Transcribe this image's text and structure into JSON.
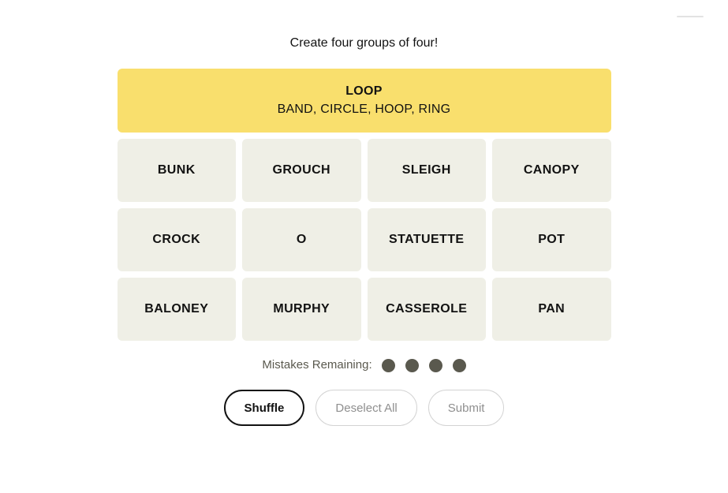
{
  "header": {
    "instruction": "Create four groups of four!"
  },
  "colors": {
    "yellow": "#F9DF6D",
    "tile_bg": "#EFEFE6",
    "text": "#121212",
    "dot": "#5A594E",
    "disabled_text": "#8F8F8F",
    "disabled_border": "#D3D3D3"
  },
  "solved_groups": [
    {
      "title": "LOOP",
      "words": "BAND, CIRCLE, HOOP, RING",
      "color": "#F9DF6D",
      "difficulty": "yellow"
    }
  ],
  "grid": {
    "rows": [
      {
        "tiles": [
          {
            "label": "BUNK"
          },
          {
            "label": "GROUCH"
          },
          {
            "label": "SLEIGH"
          },
          {
            "label": "CANOPY"
          }
        ]
      },
      {
        "tiles": [
          {
            "label": "CROCK"
          },
          {
            "label": "O"
          },
          {
            "label": "STATUETTE"
          },
          {
            "label": "POT"
          }
        ]
      },
      {
        "tiles": [
          {
            "label": "BALONEY"
          },
          {
            "label": "MURPHY"
          },
          {
            "label": "CASSEROLE"
          },
          {
            "label": "PAN"
          }
        ]
      }
    ]
  },
  "mistakes": {
    "label": "Mistakes Remaining:",
    "remaining": 4,
    "dots": [
      "dot-1",
      "dot-2",
      "dot-3",
      "dot-4"
    ]
  },
  "controls": {
    "shuffle": {
      "label": "Shuffle",
      "state": "enabled"
    },
    "deselect_all": {
      "label": "Deselect All",
      "state": "disabled"
    },
    "submit": {
      "label": "Submit",
      "state": "disabled"
    }
  }
}
